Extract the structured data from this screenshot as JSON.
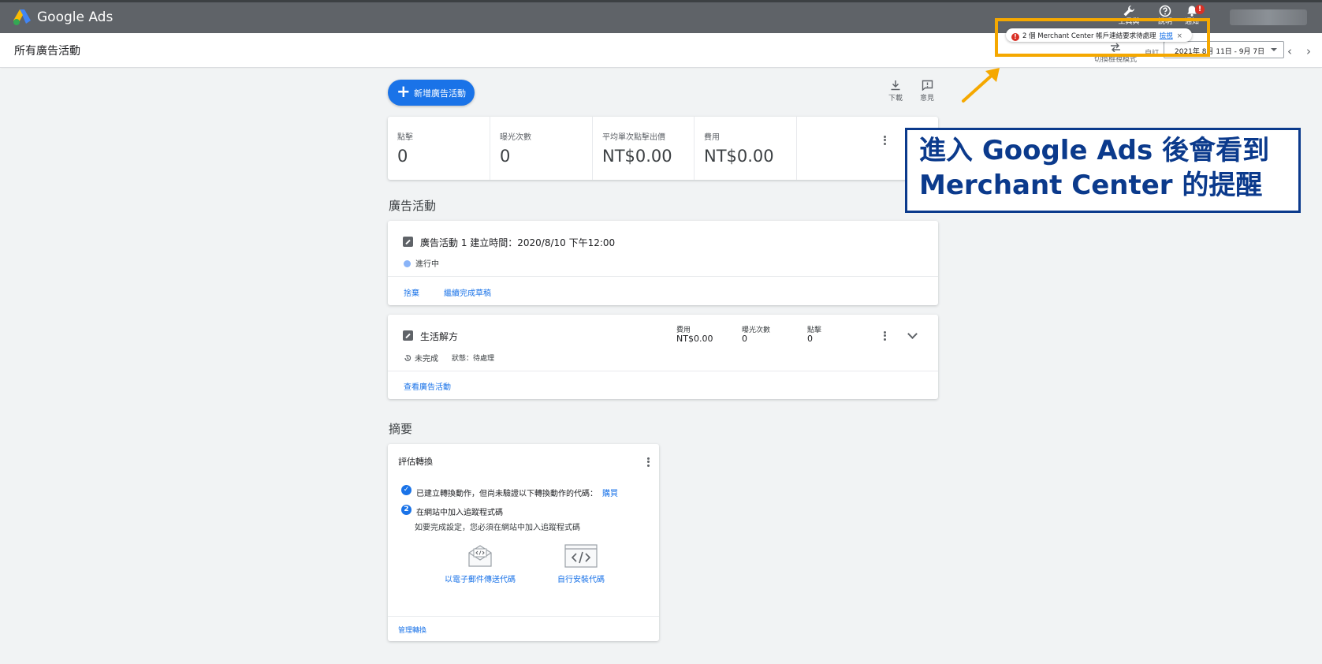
{
  "app": {
    "title": "Google Ads"
  },
  "topbar": {
    "tools_label": "工具與",
    "help_label": "說明",
    "notifications_label": "通知",
    "notifications_badge": "!"
  },
  "notice": {
    "text": "2 個 Merchant Center 帳戶連結要求待處理",
    "review_label": "檢視",
    "close": "×",
    "error_mark": "!"
  },
  "header": {
    "page_title": "所有廣告活動",
    "switch_view_label": "切換檢視模式",
    "custom_label": "自訂",
    "date_range": "2021年 8月 11日 - 9月 7日",
    "prev": "‹",
    "next": "›"
  },
  "toolbar": {
    "new_campaign_label": "新增廣告活動",
    "download_label": "下載",
    "feedback_label": "意見"
  },
  "metrics": [
    {
      "name": "點擊",
      "value": "0"
    },
    {
      "name": "曝光次數",
      "value": "0"
    },
    {
      "name": "平均單次點擊出價",
      "value": "NT$0.00"
    },
    {
      "name": "費用",
      "value": "NT$0.00"
    }
  ],
  "campaigns_section": {
    "title": "廣告活動",
    "campaign1": {
      "name": "廣告活動 1 建立時間：2020/8/10 下午12:00",
      "status": "進行中",
      "discard_label": "捨棄",
      "continue_label": "繼續完成草稿"
    },
    "campaign2": {
      "name": "生活解方",
      "state": "未完成",
      "status_text": "狀態：待處理",
      "cost_header": "費用",
      "cost_value": "NT$0.00",
      "impressions_header": "曝光次數",
      "impressions_value": "0",
      "clicks_header": "點擊",
      "clicks_value": "0",
      "view_label": "查看廣告活動"
    }
  },
  "summary": {
    "title": "摘要",
    "card_title": "評估轉換",
    "step1_text": "已建立轉換動作，但尚未驗證以下轉換動作的代碼：",
    "step1_link": "購買",
    "step2_number": "2",
    "step2_text": "在網站中加入追蹤程式碼",
    "step2_sub": "如要完成設定，您必須在網站中加入追蹤程式碼",
    "email_option": "以電子郵件傳送代碼",
    "self_install_option": "自行安裝代碼",
    "manage_label": "管理轉換"
  },
  "annotation": {
    "line1": "進入 Google Ads 後會看到",
    "line2": "Merchant Center 的提醒",
    "color": "#0b3a8c",
    "highlight_color": "#f5a800"
  }
}
